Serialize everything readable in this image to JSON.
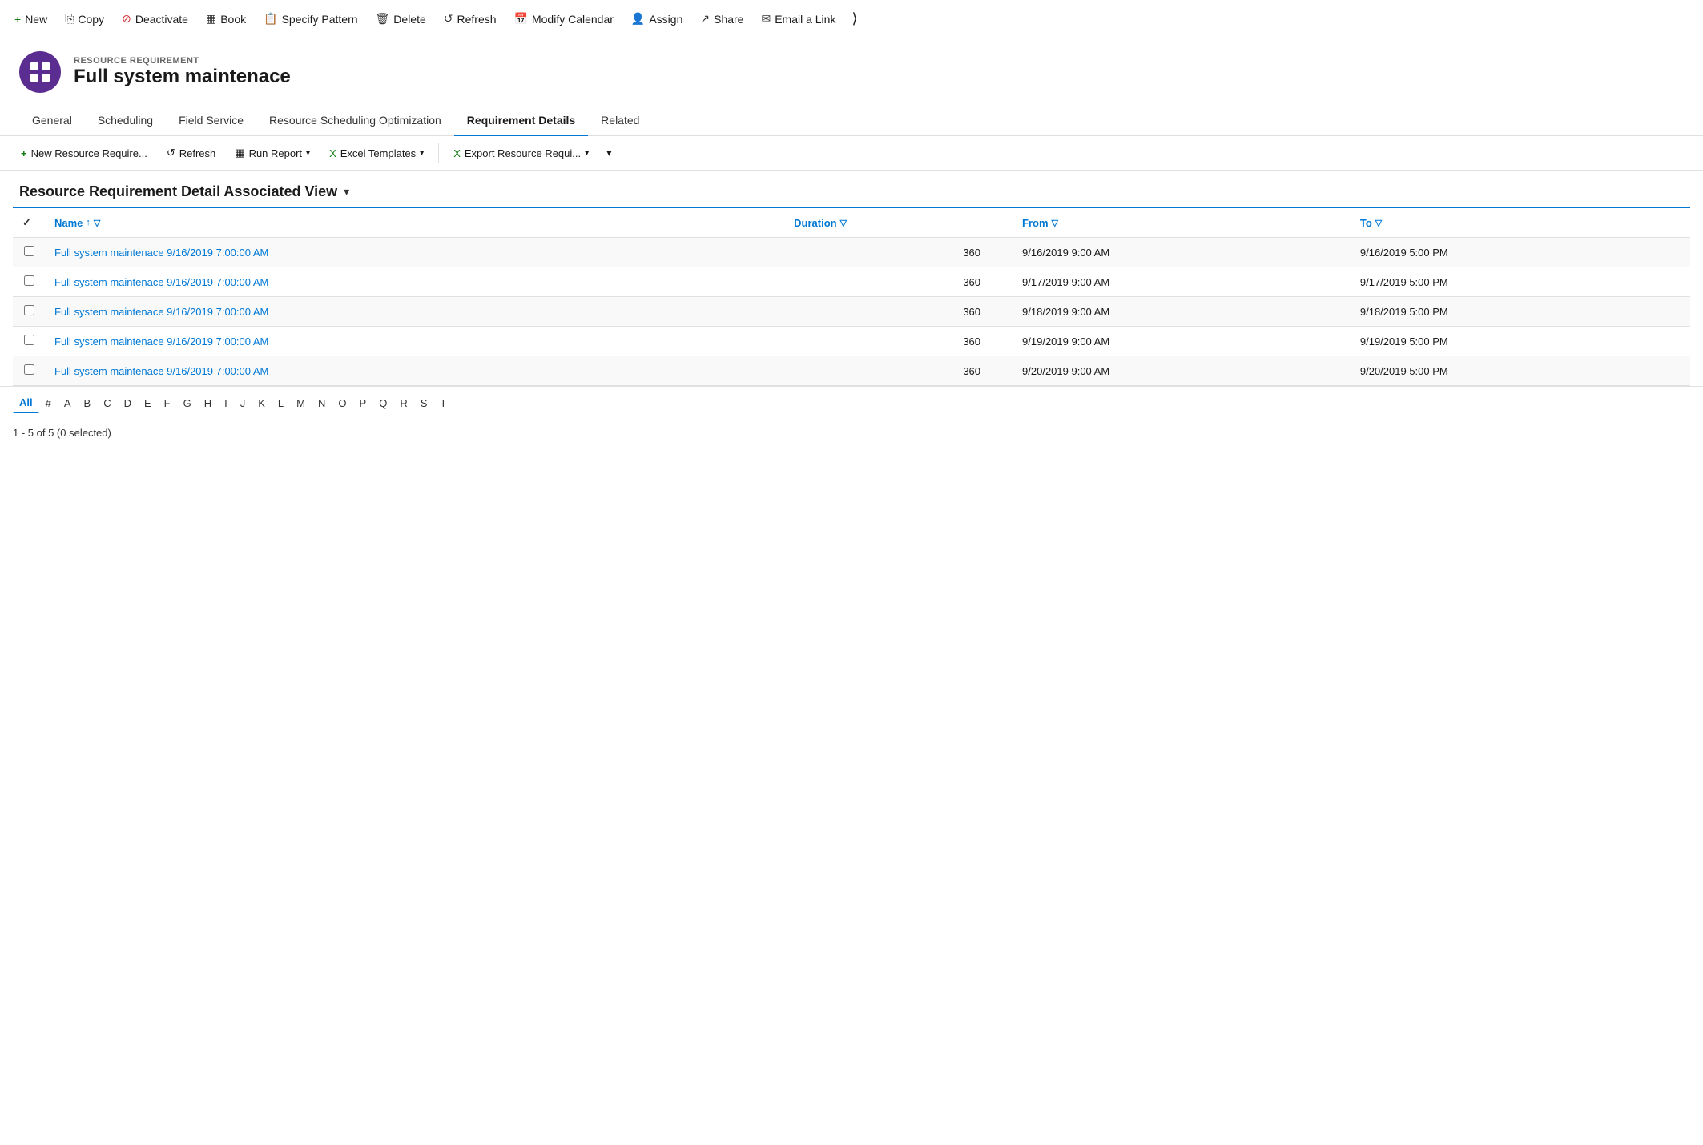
{
  "toolbar": {
    "buttons": [
      {
        "id": "new",
        "icon": "➕",
        "label": "New",
        "iconClass": "icon-green"
      },
      {
        "id": "copy",
        "icon": "📄",
        "label": "Copy",
        "iconClass": "icon"
      },
      {
        "id": "deactivate",
        "icon": "🚫",
        "label": "Deactivate",
        "iconClass": "icon-red"
      },
      {
        "id": "book",
        "icon": "📅",
        "label": "Book",
        "iconClass": "icon"
      },
      {
        "id": "specify-pattern",
        "icon": "📋",
        "label": "Specify Pattern",
        "iconClass": "icon"
      },
      {
        "id": "delete",
        "icon": "🗑️",
        "label": "Delete",
        "iconClass": "icon"
      },
      {
        "id": "refresh",
        "icon": "🔄",
        "label": "Refresh",
        "iconClass": "icon"
      },
      {
        "id": "modify-calendar",
        "icon": "📅",
        "label": "Modify Calendar",
        "iconClass": "icon"
      },
      {
        "id": "assign",
        "icon": "👤",
        "label": "Assign",
        "iconClass": "icon"
      },
      {
        "id": "share",
        "icon": "↗️",
        "label": "Share",
        "iconClass": "icon"
      },
      {
        "id": "email-link",
        "icon": "✉️",
        "label": "Email a Link",
        "iconClass": "icon"
      }
    ]
  },
  "record": {
    "type": "RESOURCE REQUIREMENT",
    "name": "Full system maintenace",
    "avatar_icon": "⊞"
  },
  "nav": {
    "tabs": [
      {
        "id": "general",
        "label": "General",
        "active": false
      },
      {
        "id": "scheduling",
        "label": "Scheduling",
        "active": false
      },
      {
        "id": "field-service",
        "label": "Field Service",
        "active": false
      },
      {
        "id": "rso",
        "label": "Resource Scheduling Optimization",
        "active": false
      },
      {
        "id": "requirement-details",
        "label": "Requirement Details",
        "active": true
      },
      {
        "id": "related",
        "label": "Related",
        "active": false
      }
    ]
  },
  "sub_toolbar": {
    "buttons": [
      {
        "id": "new-resource-req",
        "icon": "➕",
        "label": "New Resource Require..."
      },
      {
        "id": "refresh-sub",
        "icon": "🔄",
        "label": "Refresh"
      },
      {
        "id": "run-report",
        "icon": "📊",
        "label": "Run Report",
        "has_caret": true
      },
      {
        "id": "excel-templates",
        "icon": "📊",
        "label": "Excel Templates",
        "has_caret": true
      },
      {
        "id": "export-resource",
        "icon": "📊",
        "label": "Export Resource Requi...",
        "has_caret": true
      }
    ]
  },
  "view": {
    "title": "Resource Requirement Detail Associated View"
  },
  "grid": {
    "columns": [
      {
        "id": "check",
        "label": "✓",
        "is_check": true
      },
      {
        "id": "name",
        "label": "Name",
        "has_sort": true,
        "has_filter": true
      },
      {
        "id": "duration",
        "label": "Duration",
        "has_filter": true
      },
      {
        "id": "from",
        "label": "From",
        "has_filter": true
      },
      {
        "id": "to",
        "label": "To",
        "has_filter": true
      }
    ],
    "rows": [
      {
        "id": 1,
        "name": "Full system maintenace 9/16/2019 7:00:00 AM",
        "duration": "360",
        "from": "9/16/2019 9:00 AM",
        "to": "9/16/2019 5:00 PM"
      },
      {
        "id": 2,
        "name": "Full system maintenace 9/16/2019 7:00:00 AM",
        "duration": "360",
        "from": "9/17/2019 9:00 AM",
        "to": "9/17/2019 5:00 PM"
      },
      {
        "id": 3,
        "name": "Full system maintenace 9/16/2019 7:00:00 AM",
        "duration": "360",
        "from": "9/18/2019 9:00 AM",
        "to": "9/18/2019 5:00 PM"
      },
      {
        "id": 4,
        "name": "Full system maintenace 9/16/2019 7:00:00 AM",
        "duration": "360",
        "from": "9/19/2019 9:00 AM",
        "to": "9/19/2019 5:00 PM"
      },
      {
        "id": 5,
        "name": "Full system maintenace 9/16/2019 7:00:00 AM",
        "duration": "360",
        "from": "9/20/2019 9:00 AM",
        "to": "9/20/2019 5:00 PM"
      }
    ]
  },
  "pagination": {
    "alpha_items": [
      "All",
      "#",
      "A",
      "B",
      "C",
      "D",
      "E",
      "F",
      "G",
      "H",
      "I",
      "J",
      "K",
      "L",
      "M",
      "N",
      "O",
      "P",
      "Q",
      "R",
      "S",
      "T"
    ],
    "active": "All"
  },
  "record_count": "1 - 5 of 5 (0 selected)"
}
